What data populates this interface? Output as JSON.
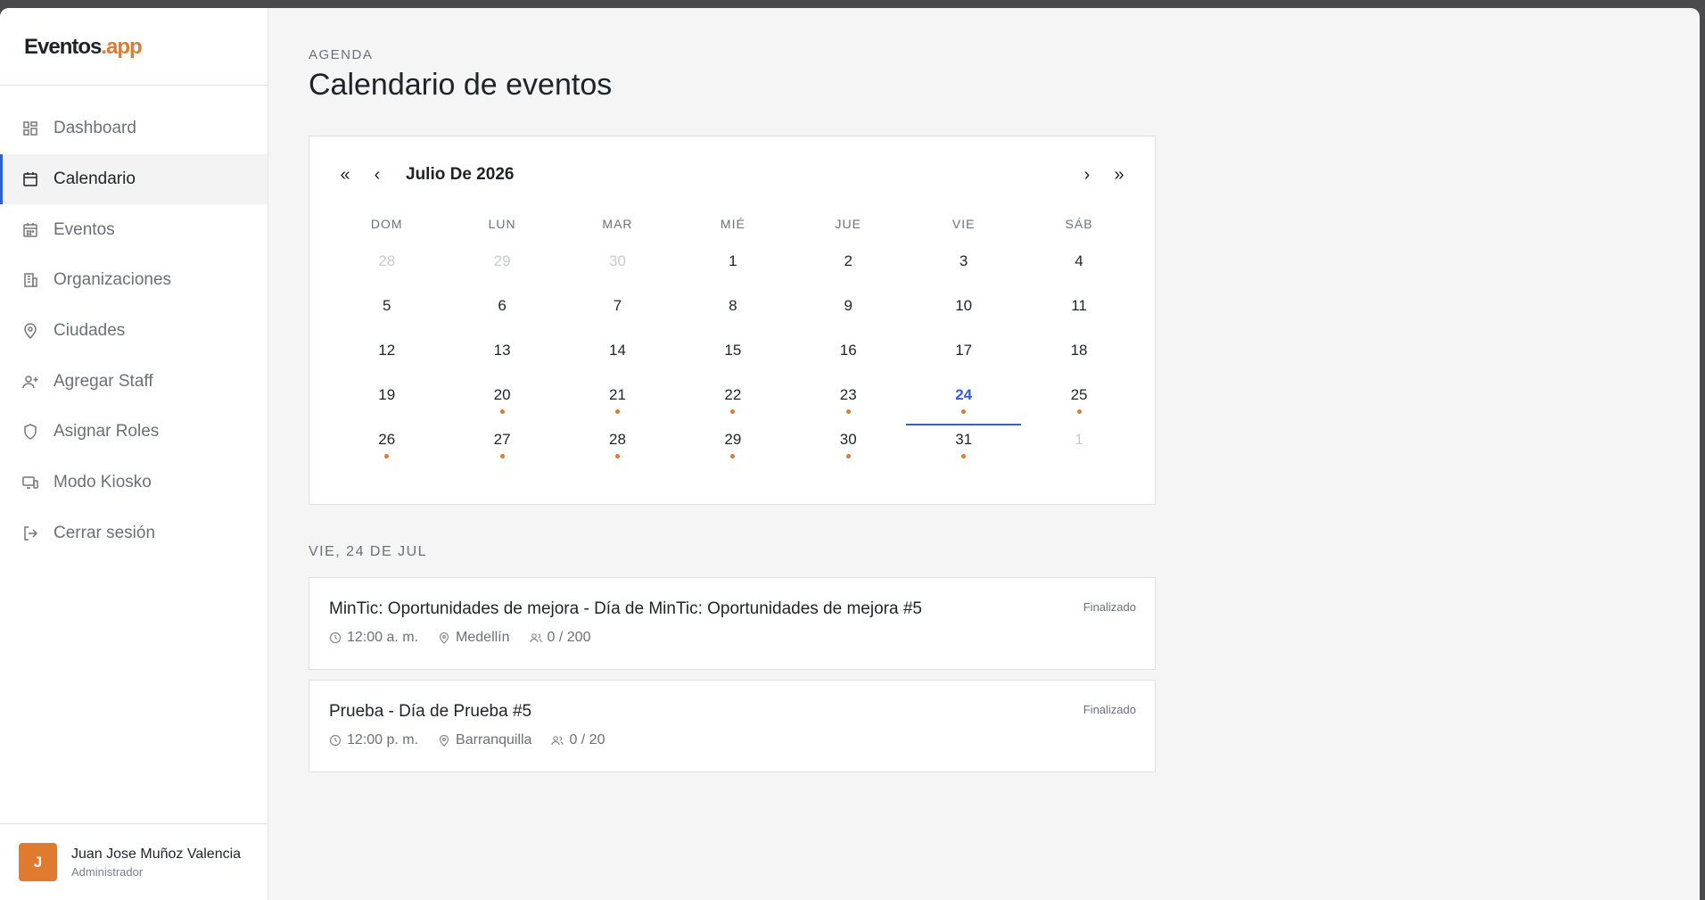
{
  "app": {
    "logo_part1": "Eventos",
    "logo_part2": ".app",
    "accent": "#e07a2e",
    "primary": "#2f5fd0"
  },
  "sidebar": {
    "items": [
      {
        "label": "Dashboard",
        "icon": "grid-icon"
      },
      {
        "label": "Calendario",
        "icon": "calendar-icon",
        "active": true
      },
      {
        "label": "Eventos",
        "icon": "calendar-grid-icon"
      },
      {
        "label": "Organizaciones",
        "icon": "building-icon"
      },
      {
        "label": "Ciudades",
        "icon": "map-pin-icon"
      },
      {
        "label": "Agregar Staff",
        "icon": "user-plus-icon"
      },
      {
        "label": "Asignar Roles",
        "icon": "shield-icon"
      },
      {
        "label": "Modo Kiosko",
        "icon": "monitor-icon"
      },
      {
        "label": "Cerrar sesión",
        "icon": "logout-icon"
      }
    ],
    "user": {
      "initial": "J",
      "name": "Juan Jose Muñoz Valencia",
      "role": "Administrador"
    }
  },
  "header": {
    "eyebrow": "AGENDA",
    "title": "Calendario de eventos"
  },
  "calendar": {
    "month_label": "Julio De 2026",
    "nav": {
      "first": "«",
      "prev": "‹",
      "next": "›",
      "last": "»"
    },
    "weekdays": [
      "DOM",
      "LUN",
      "MAR",
      "MIÉ",
      "JUE",
      "VIE",
      "SÁB"
    ],
    "weeks": [
      [
        {
          "d": "28",
          "m": true
        },
        {
          "d": "29",
          "m": true
        },
        {
          "d": "30",
          "m": true
        },
        {
          "d": "1"
        },
        {
          "d": "2"
        },
        {
          "d": "3"
        },
        {
          "d": "4"
        }
      ],
      [
        {
          "d": "5"
        },
        {
          "d": "6"
        },
        {
          "d": "7"
        },
        {
          "d": "8"
        },
        {
          "d": "9"
        },
        {
          "d": "10"
        },
        {
          "d": "11"
        }
      ],
      [
        {
          "d": "12"
        },
        {
          "d": "13"
        },
        {
          "d": "14"
        },
        {
          "d": "15"
        },
        {
          "d": "16"
        },
        {
          "d": "17"
        },
        {
          "d": "18"
        }
      ],
      [
        {
          "d": "19"
        },
        {
          "d": "20",
          "e": true
        },
        {
          "d": "21",
          "e": true
        },
        {
          "d": "22",
          "e": true
        },
        {
          "d": "23",
          "e": true
        },
        {
          "d": "24",
          "e": true,
          "today": true
        },
        {
          "d": "25",
          "e": true
        }
      ],
      [
        {
          "d": "26",
          "e": true
        },
        {
          "d": "27",
          "e": true
        },
        {
          "d": "28",
          "e": true
        },
        {
          "d": "29",
          "e": true
        },
        {
          "d": "30",
          "e": true
        },
        {
          "d": "31",
          "e": true
        },
        {
          "d": "1",
          "m": true
        }
      ]
    ]
  },
  "day": {
    "label": "VIE, 24 DE JUL",
    "events": [
      {
        "title": "MinTic: Oportunidades de mejora - Día de MinTic: Oportunidades de mejora #5",
        "status": "Finalizado",
        "time": "12:00 a. m.",
        "city": "Medellín",
        "capacity": "0 / 200"
      },
      {
        "title": "Prueba - Día de Prueba #5",
        "status": "Finalizado",
        "time": "12:00 p. m.",
        "city": "Barranquilla",
        "capacity": "0 / 20"
      }
    ]
  }
}
